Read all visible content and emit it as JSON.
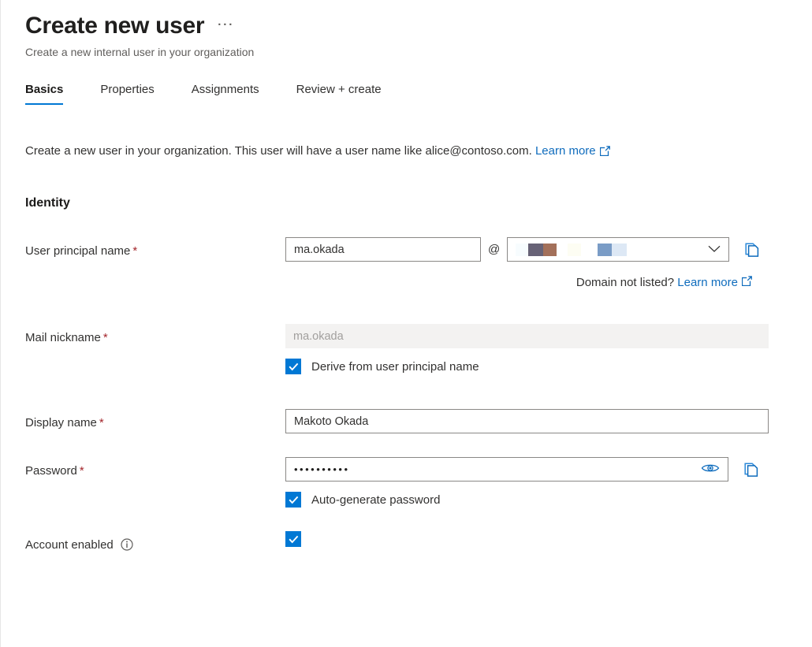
{
  "header": {
    "title": "Create new user",
    "subtitle": "Create a new internal user in your organization",
    "more_menu": "···"
  },
  "tabs": [
    {
      "label": "Basics",
      "active": true
    },
    {
      "label": "Properties",
      "active": false
    },
    {
      "label": "Assignments",
      "active": false
    },
    {
      "label": "Review + create",
      "active": false
    }
  ],
  "intro": {
    "text": "Create a new user in your organization. This user will have a user name like alice@contoso.com.",
    "link": "Learn more"
  },
  "section": {
    "identity_title": "Identity"
  },
  "fields": {
    "upn": {
      "label": "User principal name",
      "required": "*",
      "value": "ma.okada",
      "at": "@",
      "domain_redacted": true,
      "domain_not_listed": "Domain not listed?",
      "domain_link": "Learn more"
    },
    "mail_nickname": {
      "label": "Mail nickname",
      "required": "*",
      "value": "ma.okada",
      "disabled": true,
      "checkbox_label": "Derive from user principal name",
      "checked": true
    },
    "display_name": {
      "label": "Display name",
      "required": "*",
      "value": "Makoto Okada"
    },
    "password": {
      "label": "Password",
      "required": "*",
      "value": "••••••••••",
      "checkbox_label": "Auto-generate password",
      "checked": true
    },
    "account_enabled": {
      "label": "Account enabled",
      "checked": true
    }
  },
  "icons": {
    "copy": "copy-icon",
    "eye": "show-password-icon",
    "chevron": "chevron-down-icon",
    "external": "external-link-icon",
    "info": "info-icon"
  },
  "colors": {
    "accent": "#0078d4",
    "link": "#0f6cbd",
    "required": "#a4262c",
    "disabled_bg": "#f3f2f1",
    "border": "#8a8886"
  },
  "redaction_blocks": [
    {
      "color": "#f7fcfe",
      "width": 16
    },
    {
      "color": "#676276",
      "width": 19
    },
    {
      "color": "#a3705a",
      "width": 17
    },
    {
      "color": "#ffffff",
      "width": 14
    },
    {
      "color": "#fdfdf3",
      "width": 17
    },
    {
      "color": "#ffffff",
      "width": 21
    },
    {
      "color": "#7a9cc6",
      "width": 18
    },
    {
      "color": "#dde8f5",
      "width": 19
    }
  ]
}
